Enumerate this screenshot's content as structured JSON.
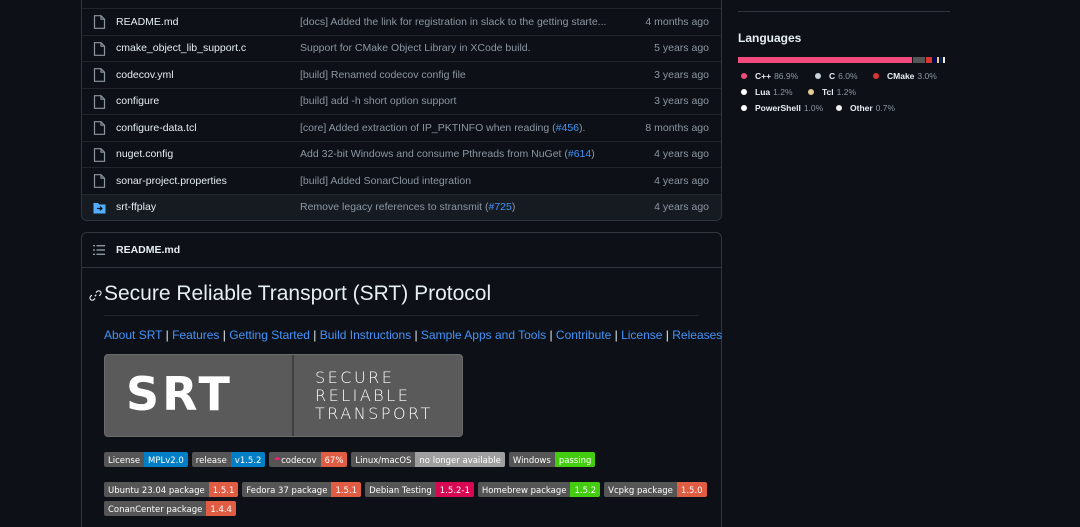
{
  "files": [
    {
      "name": "README.md",
      "message": "[docs] Added the link for registration in slack to the getting starte...",
      "pr": "",
      "message_suffix": "",
      "age": "4 months ago",
      "type": "file"
    },
    {
      "name": "cmake_object_lib_support.c",
      "message": "Support for CMake Object Library in XCode build.",
      "pr": "",
      "message_suffix": "",
      "age": "5 years ago",
      "type": "file"
    },
    {
      "name": "codecov.yml",
      "message": "[build] Renamed codecov config file",
      "pr": "",
      "message_suffix": "",
      "age": "3 years ago",
      "type": "file"
    },
    {
      "name": "configure",
      "message": "[build] add -h short option support",
      "pr": "",
      "message_suffix": "",
      "age": "3 years ago",
      "type": "file"
    },
    {
      "name": "configure-data.tcl",
      "message": "[core] Added extraction of IP_PKTINFO when reading (",
      "pr": "#456",
      "message_suffix": ").",
      "age": "8 months ago",
      "type": "file"
    },
    {
      "name": "nuget.config",
      "message": "Add 32-bit Windows and consume Pthreads from NuGet (",
      "pr": "#614",
      "message_suffix": ")",
      "age": "4 years ago",
      "type": "file"
    },
    {
      "name": "sonar-project.properties",
      "message": "[build] Added SonarCloud integration",
      "pr": "",
      "message_suffix": "",
      "age": "4 years ago",
      "type": "file"
    },
    {
      "name": "srt-ffplay",
      "message": "Remove legacy references to stransmit (",
      "pr": "#725",
      "message_suffix": ")",
      "age": "4 years ago",
      "type": "folder"
    }
  ],
  "readme": {
    "filename": "README.md",
    "title": "Secure Reliable Transport (SRT) Protocol",
    "nav": [
      {
        "label": "About SRT",
        "sep": " | "
      },
      {
        "label": "Features",
        "sep": " | "
      },
      {
        "label": "Getting Started",
        "sep": " | "
      },
      {
        "label": "Build Instructions",
        "sep": " | "
      },
      {
        "label": "Sample Apps and Tools",
        "sep": " | "
      },
      {
        "label": "Contribute",
        "sep": " | "
      },
      {
        "label": "License",
        "sep": " | "
      },
      {
        "label": "Releases",
        "sep": ""
      }
    ],
    "logo": {
      "mark": "SRT",
      "line1": "SECURE",
      "line2": "RELIABLE",
      "line3": "TRANSPORT"
    },
    "badges_row1": [
      {
        "label": "License",
        "value": "MPLv2.0",
        "color": "#007ec6"
      },
      {
        "label": "release",
        "value": "v1.5.2",
        "color": "#007ec6"
      },
      {
        "label": "codecov",
        "value": "67%",
        "color": "#e05d44"
      },
      {
        "label": "Linux/macOS",
        "value": "no longer available",
        "color": "#9f9f9f"
      },
      {
        "label": "Windows",
        "value": "passing",
        "color": "#4c1"
      }
    ],
    "badges_row2": [
      {
        "label": "Ubuntu 23.04 package",
        "value": "1.5.1",
        "color": "#e05d44"
      },
      {
        "label": "Fedora 37 package",
        "value": "1.5.1",
        "color": "#e05d44"
      },
      {
        "label": "Debian Testing",
        "value": "1.5.2-1",
        "color": "#d70751"
      },
      {
        "label": "Homebrew package",
        "value": "1.5.2",
        "color": "#4c1"
      },
      {
        "label": "Vcpkg package",
        "value": "1.5.0",
        "color": "#e05d44"
      }
    ],
    "badges_row3": [
      {
        "label": "ConanCenter package",
        "value": "1.4.4",
        "color": "#e05d44"
      }
    ]
  },
  "languages": {
    "title": "Languages",
    "items": [
      {
        "name": "C++",
        "percent": "86.9%",
        "share": 86.9,
        "color": "#f34b7d"
      },
      {
        "name": "C",
        "percent": "6.0%",
        "share": 6.0,
        "color": "#555555"
      },
      {
        "name": "CMake",
        "percent": "3.0%",
        "share": 3.0,
        "color": "#DA3434"
      },
      {
        "name": "Lua",
        "percent": "1.2%",
        "share": 1.2,
        "color": "#000080"
      },
      {
        "name": "Tcl",
        "percent": "1.2%",
        "share": 1.2,
        "color": "#e4cc98"
      },
      {
        "name": "PowerShell",
        "percent": "1.0%",
        "share": 1.0,
        "color": "#012456"
      },
      {
        "name": "Other",
        "percent": "0.7%",
        "share": 0.7,
        "color": "#ededed"
      }
    ]
  }
}
